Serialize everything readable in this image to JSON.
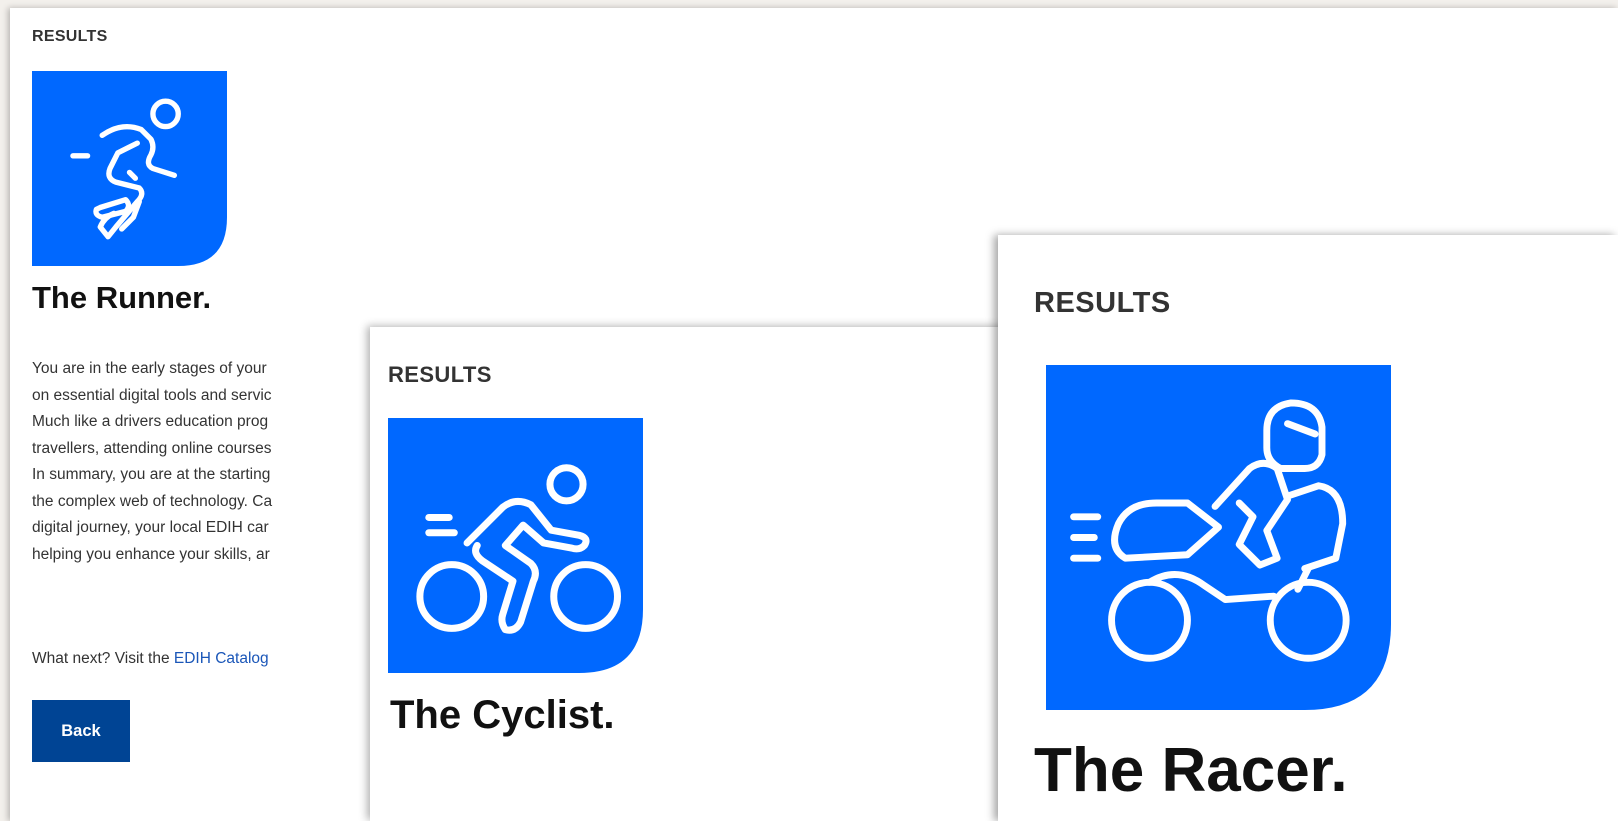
{
  "colors": {
    "tile_blue": "#0068ff",
    "button_blue": "#004494",
    "link_blue": "#1a56b8",
    "page_bg": "#f3f0ec"
  },
  "runner": {
    "results_label": "RESULTS",
    "icon": "runner-icon",
    "title": "The Runner.",
    "description_lines": [
      "You are in the early stages of your",
      "on essential digital tools and servic",
      "Much like a drivers education prog",
      "travellers, attending online courses",
      "In summary, you are at the starting",
      "the complex web of technology. Ca",
      "digital journey, your local EDIH car",
      "helping you enhance your skills, ar"
    ],
    "next_prefix": "What next? Visit the ",
    "next_link": "EDIH Catalog",
    "back_label": "Back"
  },
  "cyclist": {
    "results_label": "RESULTS",
    "icon": "cyclist-icon",
    "title": "The Cyclist."
  },
  "racer": {
    "results_label": "RESULTS",
    "icon": "motorcycle-racer-icon",
    "title": "The Racer."
  }
}
